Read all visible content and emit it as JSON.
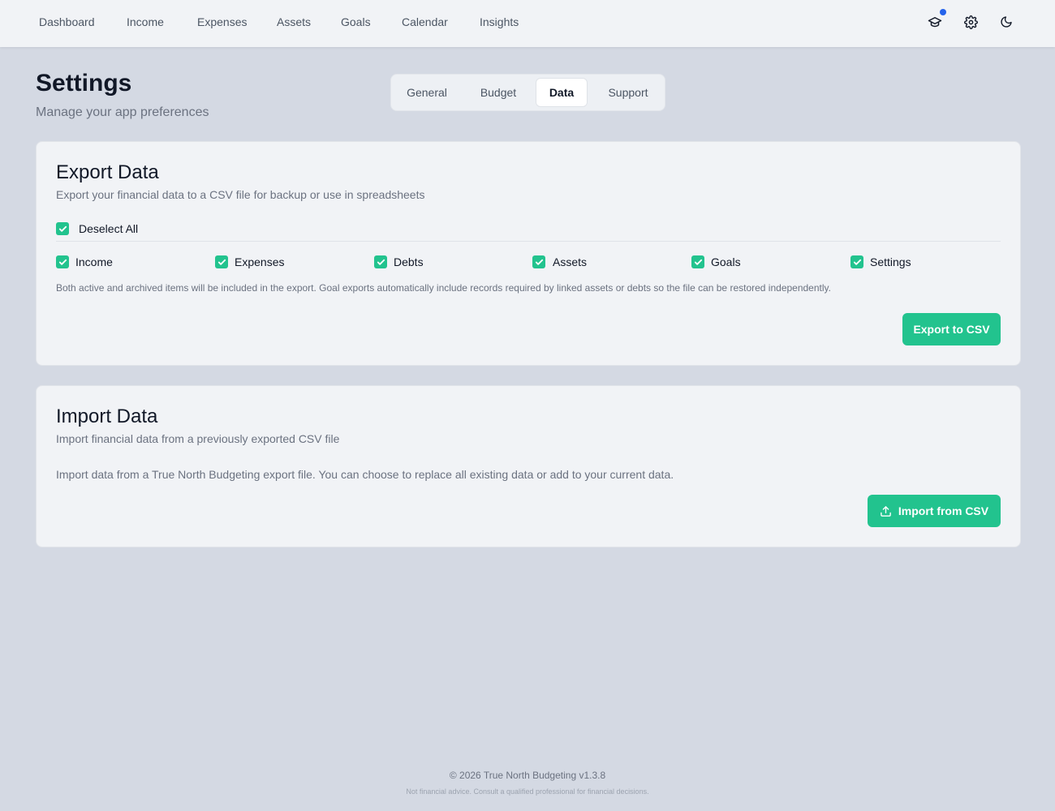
{
  "nav": {
    "items": [
      "Dashboard",
      "Income",
      "Expenses",
      "Assets",
      "Goals",
      "Calendar",
      "Insights"
    ],
    "icons": [
      "graduation-cap-icon",
      "gear-icon",
      "moon-icon"
    ]
  },
  "header": {
    "title": "Settings",
    "subtitle": "Manage your app preferences"
  },
  "tabs": [
    {
      "label": "General",
      "active": false
    },
    {
      "label": "Budget",
      "active": false
    },
    {
      "label": "Data",
      "active": true
    },
    {
      "label": "Support",
      "active": false
    }
  ],
  "export": {
    "title": "Export Data",
    "description": "Export your financial data to a CSV file for backup or use in spreadsheets",
    "toggle_all_label": "Deselect All",
    "categories": [
      {
        "label": "Income",
        "checked": true
      },
      {
        "label": "Expenses",
        "checked": true
      },
      {
        "label": "Debts",
        "checked": true
      },
      {
        "label": "Assets",
        "checked": true
      },
      {
        "label": "Goals",
        "checked": true
      },
      {
        "label": "Settings",
        "checked": true
      }
    ],
    "note": "Both active and archived items will be included in the export. Goal exports automatically include records required by linked assets or debts so the file can be restored independently.",
    "button_label": "Export to CSV"
  },
  "import": {
    "title": "Import Data",
    "description": "Import financial data from a previously exported CSV file",
    "body": "Import data from a True North Budgeting export file. You can choose to replace all existing data or add to your current data.",
    "button_label": "Import from CSV"
  },
  "footer": {
    "copyright": "© 2026 True North Budgeting v1.3.8",
    "disclaimer": "Not financial advice. Consult a qualified professional for financial decisions."
  },
  "colors": {
    "accent": "#22c38e",
    "notification_dot": "#2563eb",
    "background": "#d4d9e3",
    "card": "#f1f3f6"
  }
}
